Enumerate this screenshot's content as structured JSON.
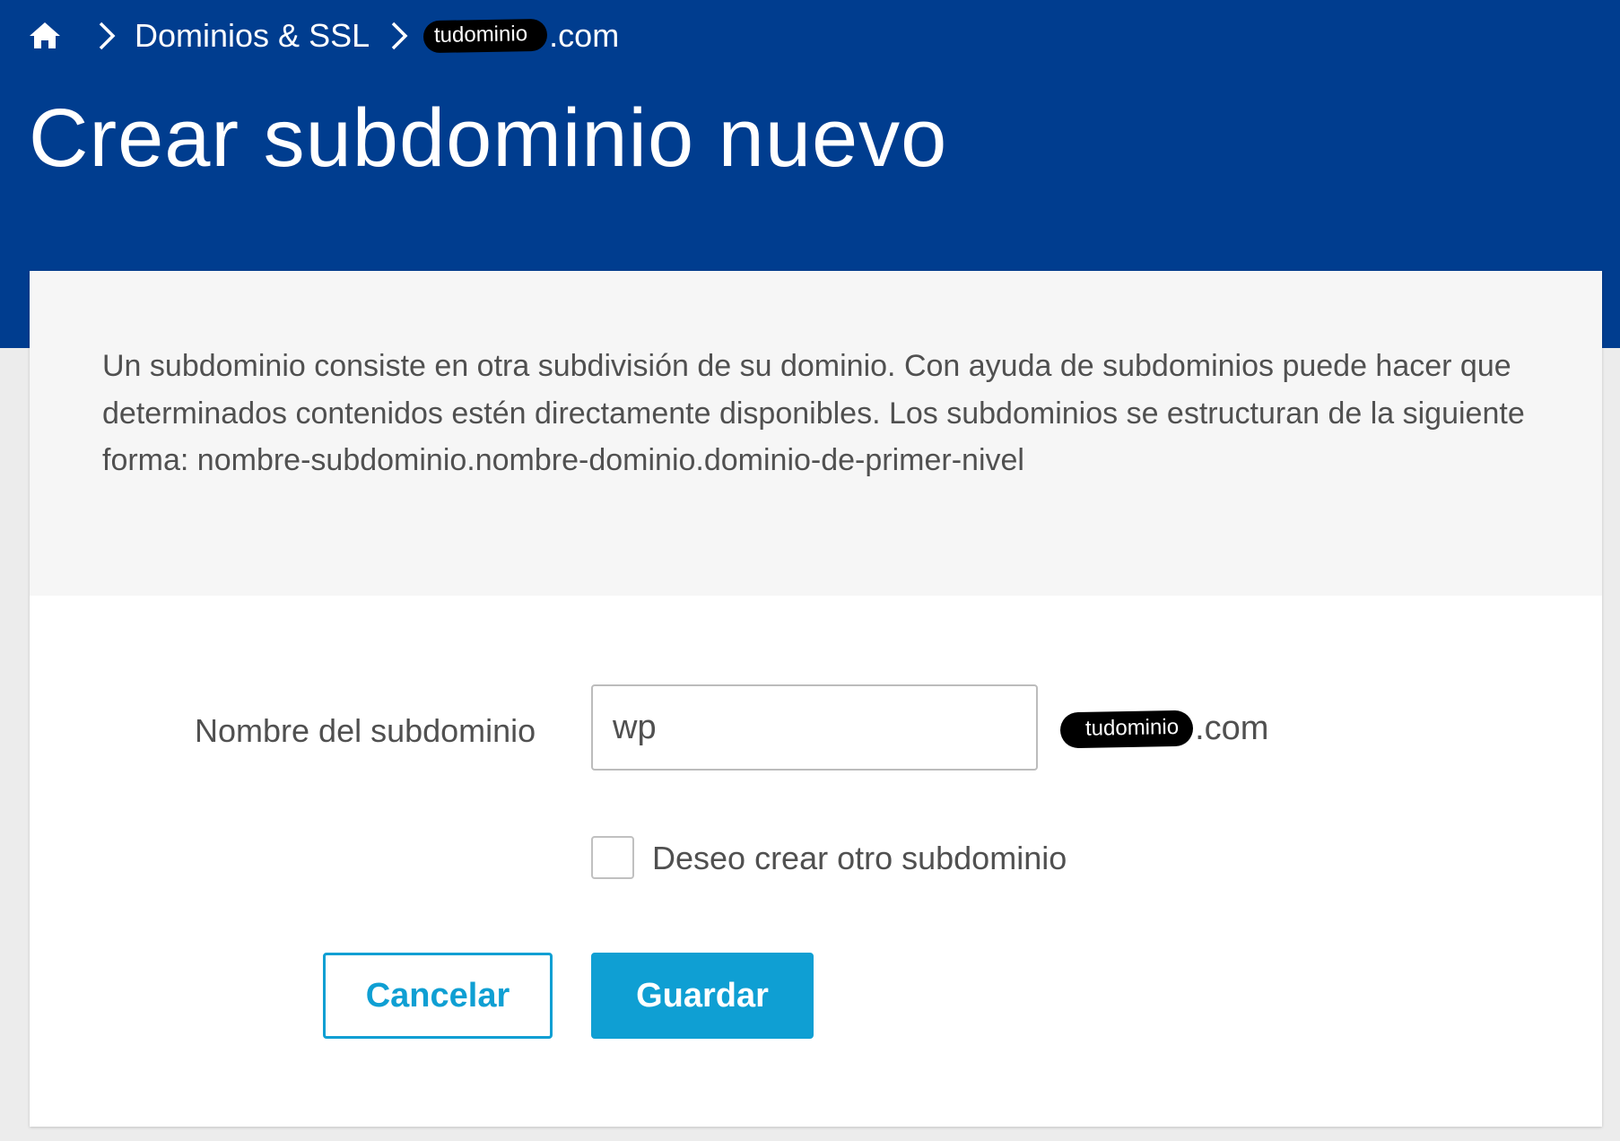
{
  "breadcrumb": {
    "home_icon": "home-icon",
    "items": [
      {
        "label": "Dominios & SSL"
      },
      {
        "redacted": "tudominio",
        "suffix": ".com"
      }
    ]
  },
  "page": {
    "title": "Crear subdominio nuevo"
  },
  "info": {
    "text": "Un subdominio consiste en otra subdivisión de su dominio. Con ayuda de subdominios puede hacer que determinados contenidos estén directamente disponibles. Los subdominios se estructuran de la siguiente forma: nombre-subdominio.nombre-dominio.dominio-de-primer-nivel"
  },
  "form": {
    "subdomain_label": "Nombre del subdominio",
    "subdomain_value": "wp",
    "domain_redacted": "tudominio",
    "domain_suffix": ".com",
    "another_label": "Deseo crear otro subdominio",
    "another_checked": false,
    "cancel_label": "Cancelar",
    "save_label": "Guardar"
  },
  "colors": {
    "header": "#003d8f",
    "accent": "#0f9fd3",
    "text": "#505050"
  }
}
